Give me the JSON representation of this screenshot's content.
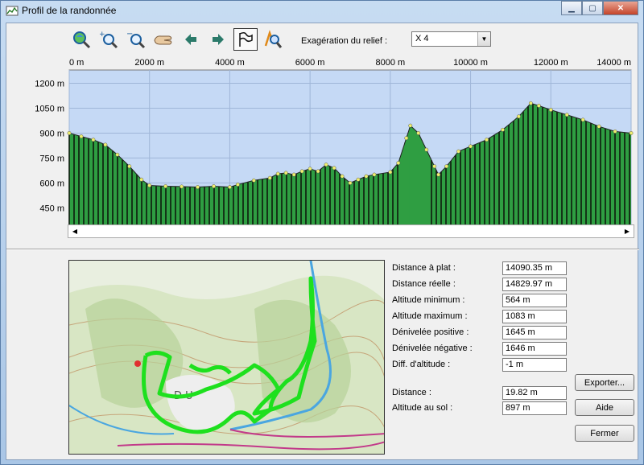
{
  "window": {
    "title": "Profil de la randonnée"
  },
  "toolbar": {
    "tools": [
      "zoom-fit-icon",
      "zoom-in-icon",
      "zoom-out-icon",
      "pan-hand-icon",
      "arrow-left-icon",
      "arrow-right-icon",
      "profile-flag-icon",
      "track-zoom-icon"
    ],
    "relief_label": "Exagération du relief :",
    "relief_value": "X 4"
  },
  "chart_data": {
    "type": "area",
    "xlabel": "",
    "ylabel": "",
    "xlim": [
      0,
      14000
    ],
    "ylim": [
      350,
      1280
    ],
    "x_ticks": [
      0,
      2000,
      4000,
      6000,
      8000,
      10000,
      12000,
      14000
    ],
    "x_tick_labels": [
      "0 m",
      "2000 m",
      "4000 m",
      "6000 m",
      "8000 m",
      "10000 m",
      "12000 m",
      "14000 m"
    ],
    "y_ticks": [
      450,
      600,
      750,
      900,
      1050,
      1200
    ],
    "y_tick_labels": [
      "450 m",
      "600 m",
      "750 m",
      "900 m",
      "1050 m",
      "1200 m"
    ],
    "grid": true,
    "colors": {
      "background": "#c5d9f5",
      "fill_dark": "#0d1a0d",
      "fill_green": "#2f9e42",
      "point": "#f0ef6e"
    },
    "x": [
      0,
      300,
      600,
      900,
      1200,
      1500,
      1800,
      2000,
      2400,
      2800,
      3200,
      3600,
      4000,
      4200,
      4600,
      5000,
      5200,
      5400,
      5600,
      5800,
      6000,
      6200,
      6400,
      6600,
      6800,
      7000,
      7200,
      7400,
      7600,
      8000,
      8200,
      8400,
      8500,
      8700,
      8900,
      9100,
      9200,
      9400,
      9700,
      10000,
      10400,
      10800,
      11200,
      11500,
      11700,
      12000,
      12400,
      12800,
      13200,
      13600,
      14000
    ],
    "y": [
      900,
      880,
      860,
      830,
      770,
      700,
      620,
      585,
      580,
      578,
      575,
      580,
      575,
      590,
      615,
      630,
      655,
      660,
      650,
      670,
      685,
      670,
      710,
      690,
      640,
      600,
      620,
      640,
      650,
      665,
      720,
      870,
      945,
      900,
      800,
      700,
      650,
      700,
      790,
      820,
      860,
      920,
      1000,
      1080,
      1065,
      1040,
      1010,
      980,
      940,
      910,
      900
    ]
  },
  "stats": [
    {
      "label": "Distance à plat :",
      "value": "14090.35 m"
    },
    {
      "label": "Distance réelle :",
      "value": "14829.97 m"
    },
    {
      "label": "Altitude minimum :",
      "value": "564 m"
    },
    {
      "label": "Altitude maximum :",
      "value": "1083 m"
    },
    {
      "label": "Dénivelée positive :",
      "value": "1645 m"
    },
    {
      "label": "Dénivelée négative :",
      "value": "1646 m"
    },
    {
      "label": "Diff. d'altitude :",
      "value": "-1 m"
    }
  ],
  "cursor": [
    {
      "label": "Distance :",
      "value": "19.82 m"
    },
    {
      "label": "Altitude au sol :",
      "value": "897 m"
    }
  ],
  "buttons": {
    "export": "Exporter...",
    "help": "Aide",
    "close": "Fermer"
  },
  "map": {
    "label": "D U"
  }
}
